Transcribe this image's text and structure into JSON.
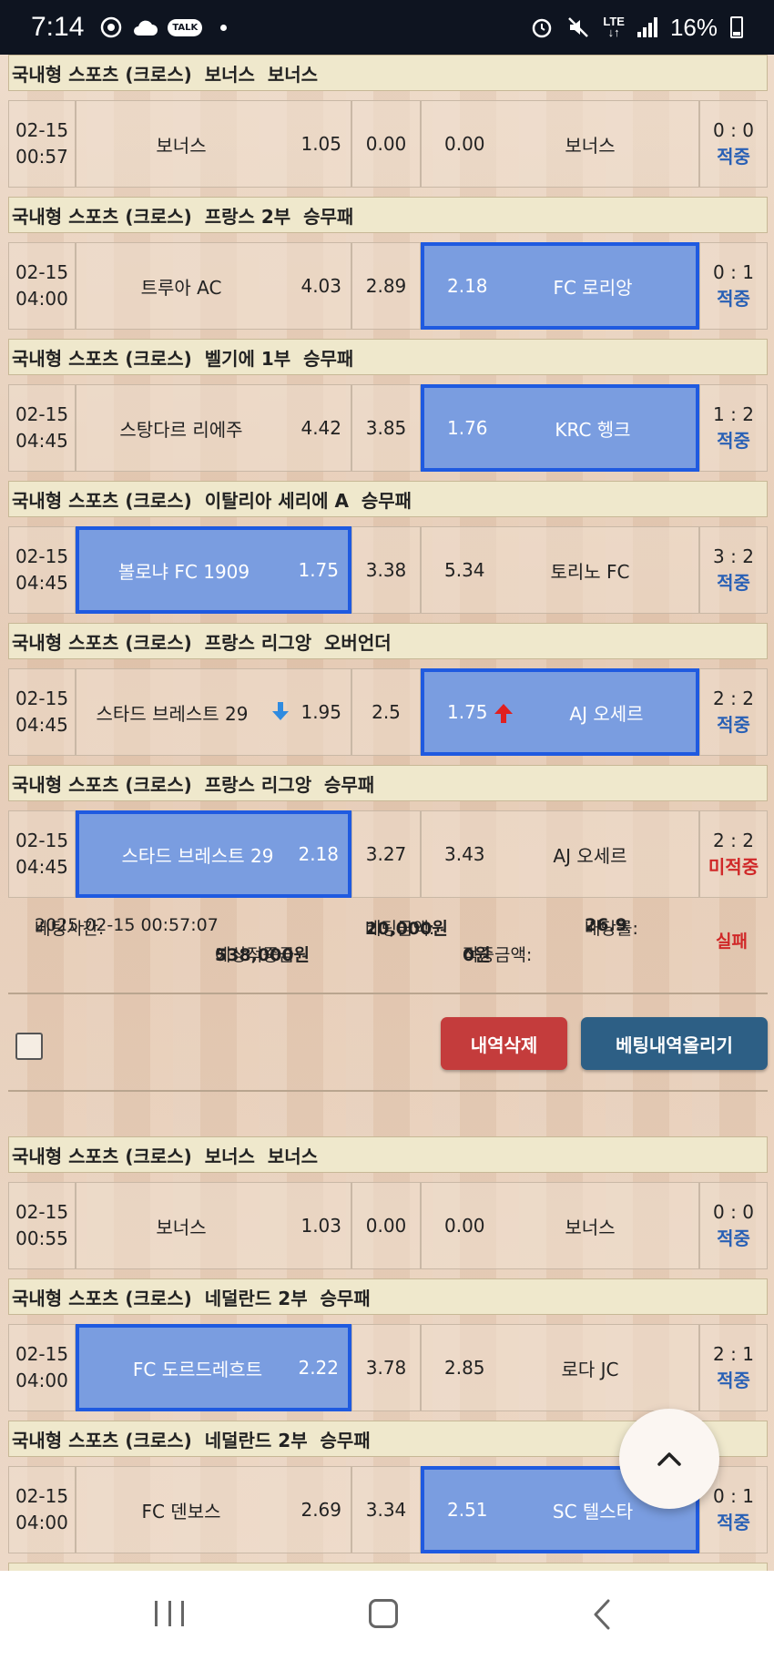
{
  "status_bar": {
    "time": "7:14",
    "battery": "16%",
    "network": "LTE",
    "icons": [
      "chrome-icon",
      "cloud-icon",
      "kakaotalk-icon",
      "alarm-icon",
      "mute-icon",
      "signal-icon",
      "battery-icon"
    ],
    "talk_label": "TALK"
  },
  "groups": [
    {
      "header": "국내형 스포츠 (크로스)  보너스  보너스",
      "date": "02-15",
      "time": "00:57",
      "home": "보너스",
      "home_odd": "1.05",
      "draw": "0.00",
      "away_odd": "0.00",
      "away": "보너스",
      "score": "0 : 0",
      "result": "적중",
      "selected": "none"
    },
    {
      "header": "국내형 스포츠 (크로스)  프랑스 2부  승무패",
      "date": "02-15",
      "time": "04:00",
      "home": "트루아 AC",
      "home_odd": "4.03",
      "draw": "2.89",
      "away_odd": "2.18",
      "away": "FC 로리앙",
      "score": "0 : 1",
      "result": "적중",
      "selected": "away"
    },
    {
      "header": "국내형 스포츠 (크로스)  벨기에 1부  승무패",
      "date": "02-15",
      "time": "04:45",
      "home": "스탕다르 리에주",
      "home_odd": "4.42",
      "draw": "3.85",
      "away_odd": "1.76",
      "away": "KRC 헹크",
      "score": "1 : 2",
      "result": "적중",
      "selected": "away"
    },
    {
      "header": "국내형 스포츠 (크로스)  이탈리아 세리에 A  승무패",
      "date": "02-15",
      "time": "04:45",
      "home": "볼로냐 FC 1909",
      "home_odd": "1.75",
      "draw": "3.38",
      "away_odd": "5.34",
      "away": "토리노 FC",
      "score": "3 : 2",
      "result": "적중",
      "selected": "home"
    },
    {
      "header": "국내형 스포츠 (크로스)  프랑스 리그앙  오버언더",
      "date": "02-15",
      "time": "04:45",
      "home": "스타드 브레스트 29",
      "home_odd": "1.95",
      "draw": "2.5",
      "away_odd": "1.75",
      "away": "AJ 오세르",
      "score": "2 : 2",
      "result": "적중",
      "selected": "away"
    },
    {
      "header": "국내형 스포츠 (크로스)  프랑스 리그앙  승무패",
      "date": "02-15",
      "time": "04:45",
      "home": "스타드 브레스트 29",
      "home_odd": "2.18",
      "draw": "3.27",
      "away_odd": "3.43",
      "away": "AJ 오세르",
      "score": "2 : 2",
      "result": "미적중",
      "selected": "home"
    }
  ],
  "summary": {
    "bet_time_label": "베팅시간:",
    "bet_time": "2025-02-15 00:57:07",
    "bet_amount_label": "베팅금액:",
    "bet_amount": "20,000원",
    "odds_label": "배당률:",
    "odds": "26.9",
    "status": "실패",
    "expected_label": "예상적중금:",
    "expected": "538,000원",
    "hit_amount_label": "적중금액:",
    "hit_amount": "0원"
  },
  "buttons": {
    "delete": "내역삭제",
    "upload": "베팅내역올리기"
  },
  "groups2": [
    {
      "header": "국내형 스포츠 (크로스)  보너스  보너스",
      "date": "02-15",
      "time": "00:55",
      "home": "보너스",
      "home_odd": "1.03",
      "draw": "0.00",
      "away_odd": "0.00",
      "away": "보너스",
      "score": "0 : 0",
      "result": "적중",
      "selected": "none"
    },
    {
      "header": "국내형 스포츠 (크로스)  네덜란드 2부  승무패",
      "date": "02-15",
      "time": "04:00",
      "home": "FC 도르드레흐트",
      "home_odd": "2.22",
      "draw": "3.78",
      "away_odd": "2.85",
      "away": "로다 JC",
      "score": "2 : 1",
      "result": "적중",
      "selected": "home"
    },
    {
      "header": "국내형 스포츠 (크로스)  네덜란드 2부  승무패",
      "date": "02-15",
      "time": "04:00",
      "home": "FC 덴보스",
      "home_odd": "2.69",
      "draw": "3.34",
      "away_odd": "2.51",
      "away": "SC 텔스타",
      "score": "0 : 1",
      "result": "적중",
      "selected": "away"
    }
  ]
}
